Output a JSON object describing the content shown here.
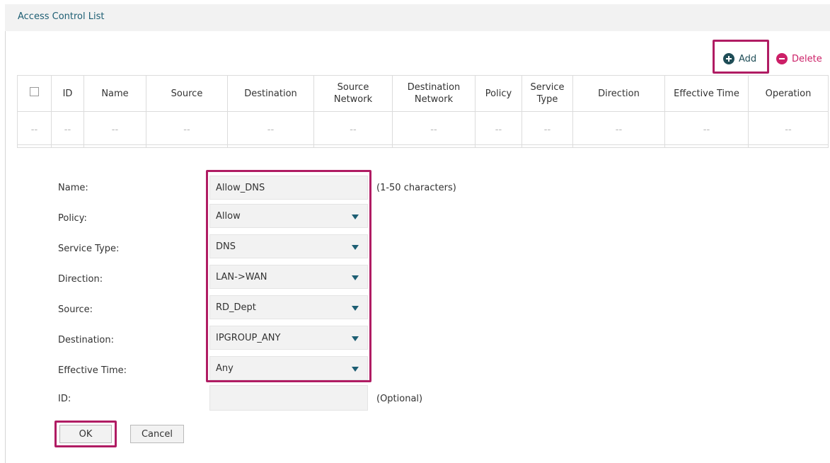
{
  "header": {
    "title": "Access Control List"
  },
  "toolbar": {
    "add_label": "Add",
    "delete_label": "Delete"
  },
  "table": {
    "columns": [
      "ID",
      "Name",
      "Source",
      "Destination",
      "Source Network",
      "Destination Network",
      "Policy",
      "Service Type",
      "Direction",
      "Effective Time",
      "Operation"
    ],
    "empty_cell": "--"
  },
  "form": {
    "name_label": "Name:",
    "name_value": "Allow_DNS",
    "name_hint": "(1-50 characters)",
    "policy_label": "Policy:",
    "policy_value": "Allow",
    "service_type_label": "Service Type:",
    "service_type_value": "DNS",
    "direction_label": "Direction:",
    "direction_value": "LAN->WAN",
    "source_label": "Source:",
    "source_value": "RD_Dept",
    "destination_label": "Destination:",
    "destination_value": "IPGROUP_ANY",
    "effective_time_label": "Effective Time:",
    "effective_time_value": "Any",
    "id_label": "ID:",
    "id_value": "",
    "id_hint": "(Optional)",
    "ok_label": "OK",
    "cancel_label": "Cancel"
  },
  "colors": {
    "accent": "#b01c63",
    "title_text": "#1d5e73",
    "add_icon": "#1f4d57",
    "delete": "#cc1f67"
  }
}
